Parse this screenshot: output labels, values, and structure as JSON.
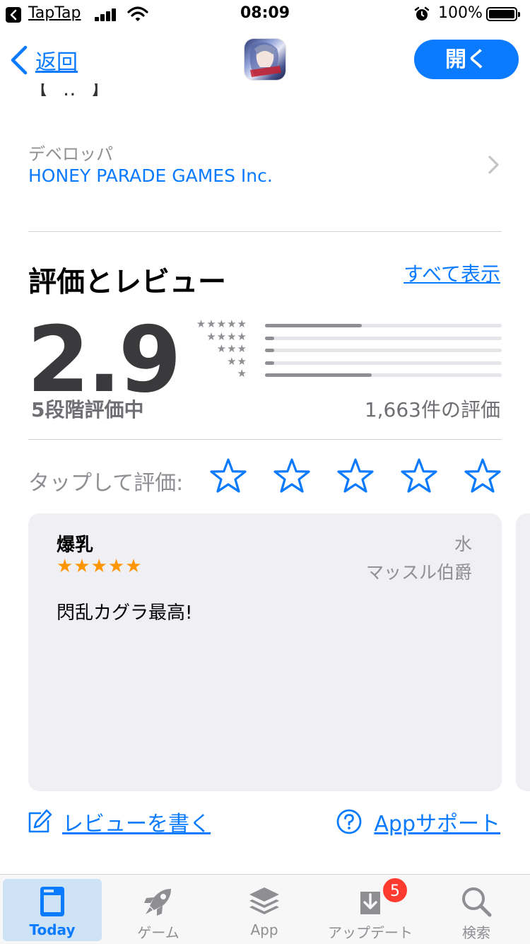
{
  "status_bar": {
    "back_app": "TapTap",
    "time": "08:09",
    "battery": "100%"
  },
  "nav": {
    "back_label": "返回",
    "open_label": "開く"
  },
  "developer": {
    "label": "デベロッパ",
    "name": "HONEY PARADE GAMES Inc."
  },
  "ratings": {
    "title": "評価とレビュー",
    "see_all": "すべて表示",
    "score": "2.9",
    "out_of": "5段階評価中",
    "count": "1,663件の評価",
    "histogram": [
      {
        "stars": "★★★★★",
        "fraction": 0.41
      },
      {
        "stars": "★★★★",
        "fraction": 0.04
      },
      {
        "stars": "★★★",
        "fraction": 0.04
      },
      {
        "stars": "★★",
        "fraction": 0.04
      },
      {
        "stars": "★",
        "fraction": 0.45
      }
    ]
  },
  "tap_to_rate": {
    "label": "タップして評価:",
    "star_count": 5,
    "star_icon": "star-outline-icon"
  },
  "review": {
    "title": "爆乳",
    "rating_stars": "★★★★★",
    "rating": 5,
    "date": "水",
    "author": "マッスル伯爵",
    "body": "閃乱カグラ最高!"
  },
  "links": {
    "write_review": "レビューを書く",
    "app_support": "Appサポート"
  },
  "tabbar": {
    "tabs": [
      {
        "label": "Today",
        "icon": "today-icon",
        "active": true
      },
      {
        "label": "ゲーム",
        "icon": "rocket-icon",
        "active": false
      },
      {
        "label": "App",
        "icon": "layers-icon",
        "active": false
      },
      {
        "label": "アップデート",
        "icon": "download-icon",
        "active": false
      },
      {
        "label": "検索",
        "icon": "search-icon",
        "active": false
      }
    ],
    "updates_badge": "5"
  },
  "colors": {
    "accent": "#0a7aff",
    "review_star": "#ff9500",
    "badge": "#ff3b30"
  }
}
